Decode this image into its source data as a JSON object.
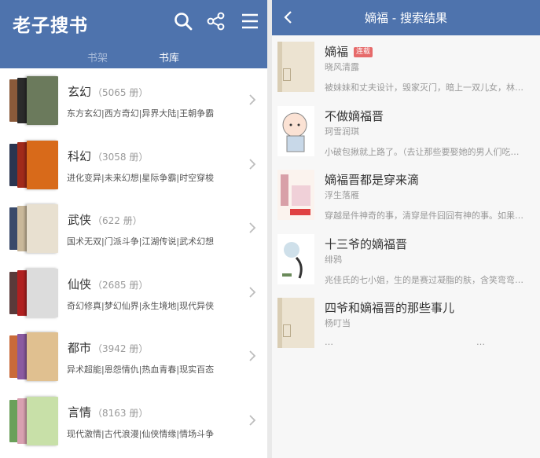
{
  "left": {
    "logo": "老子搜书",
    "tabs": {
      "shelf": "书架",
      "library": "书库"
    },
    "categories": [
      {
        "name": "玄幻",
        "count": "（5065 册）",
        "tags": "东方玄幻|西方奇幻|异界大陆|王朝争霸"
      },
      {
        "name": "科幻",
        "count": "（3058 册）",
        "tags": "进化变异|未来幻想|星际争霸|时空穿梭"
      },
      {
        "name": "武侠",
        "count": "（622 册）",
        "tags": "国术无双|门派斗争|江湖传说|武术幻想"
      },
      {
        "name": "仙侠",
        "count": "（2685 册）",
        "tags": "奇幻修真|梦幻仙界|永生境地|现代异侠"
      },
      {
        "name": "都市",
        "count": "（3942 册）",
        "tags": "异术超能|恩怨情仇|热血青春|现实百态"
      },
      {
        "name": "言情",
        "count": "（8163 册）",
        "tags": "现代激情|古代浪漫|仙侠情缘|情场斗争"
      }
    ]
  },
  "right": {
    "title": "嫡福 - 搜索结果",
    "results": [
      {
        "title": "嫡福",
        "badge": "连载",
        "author": "晓风清露",
        "desc": "被妹妹和丈夫设计，毁家灭门，暗上一双儿女，林…"
      },
      {
        "title": "不做嫡福晋",
        "author": "珂雪润琪",
        "desc": "小破包揪就上路了。（去让那些要娶她的男人们吃…"
      },
      {
        "title": "嫡福晋都是穿来滴",
        "author": "浮生落雁",
        "desc": "穿越是件神奇的事，清穿是件囧囧有神的事。如果…"
      },
      {
        "title": "十三爷的嫡福晋",
        "author": "绯鸦",
        "desc": "兆佳氏的七小姐，生的是赛过凝脂的肤，含笑弯弯…"
      },
      {
        "title": "四爷和嫡福晋的那些事儿",
        "author": "杨叮当",
        "desc": "…",
        "desc2": "…"
      }
    ]
  },
  "colors": {
    "header": "#4e73ad",
    "badge": "#e66a6a"
  },
  "icons": [
    "search-icon",
    "share-icon",
    "menu-icon",
    "chevron-right-icon",
    "back-arrow-icon"
  ]
}
